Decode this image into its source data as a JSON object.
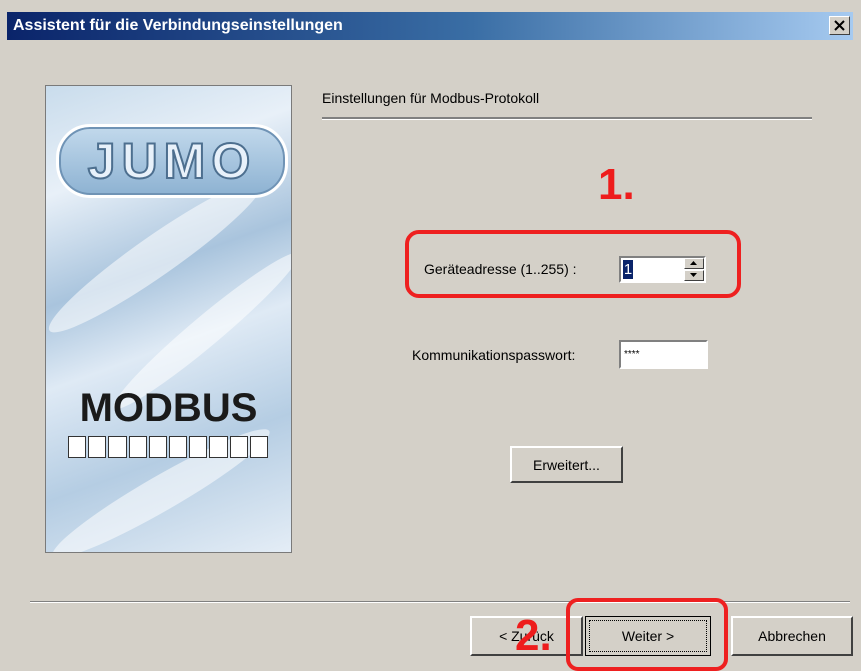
{
  "window": {
    "title": "Assistent für die Verbindungseinstellungen",
    "close_icon": "close-icon"
  },
  "image_panel": {
    "logo_text": "JUMO",
    "product_text": "MODBUS"
  },
  "section": {
    "header": "Einstellungen für Modbus-Protokoll"
  },
  "annotations": {
    "step1": "1.",
    "step2": "2.",
    "highlight_color": "#ee2020"
  },
  "device_address": {
    "label": "Geräteadresse (1..255) :",
    "value": "1"
  },
  "password": {
    "label": "Kommunikationspasswort:",
    "value": "****"
  },
  "buttons": {
    "advanced": "Erweitert...",
    "back": "< Zurück",
    "next": "Weiter >",
    "cancel": "Abbrechen"
  }
}
